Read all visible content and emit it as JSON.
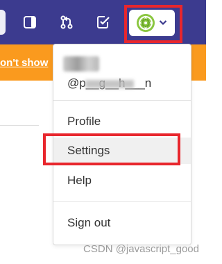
{
  "navbar": {
    "background": "#3c3b8f",
    "icons": [
      "sidebar-panel-icon",
      "merge-request-icon",
      "todo-checkbox-icon"
    ]
  },
  "avatar_button": {
    "avatar_icon": "identicon-avatar-icon",
    "caret_icon": "chevron-down-icon"
  },
  "banner": {
    "color": "#fa9a1e",
    "text": "on't show"
  },
  "user_menu": {
    "handle": "@p__g__h___n",
    "items": [
      "Profile",
      "Settings",
      "Help",
      "Sign out"
    ],
    "active_item": "Settings"
  },
  "highlight_color": "#e8262d",
  "watermark": "CSDN @javascript_good"
}
